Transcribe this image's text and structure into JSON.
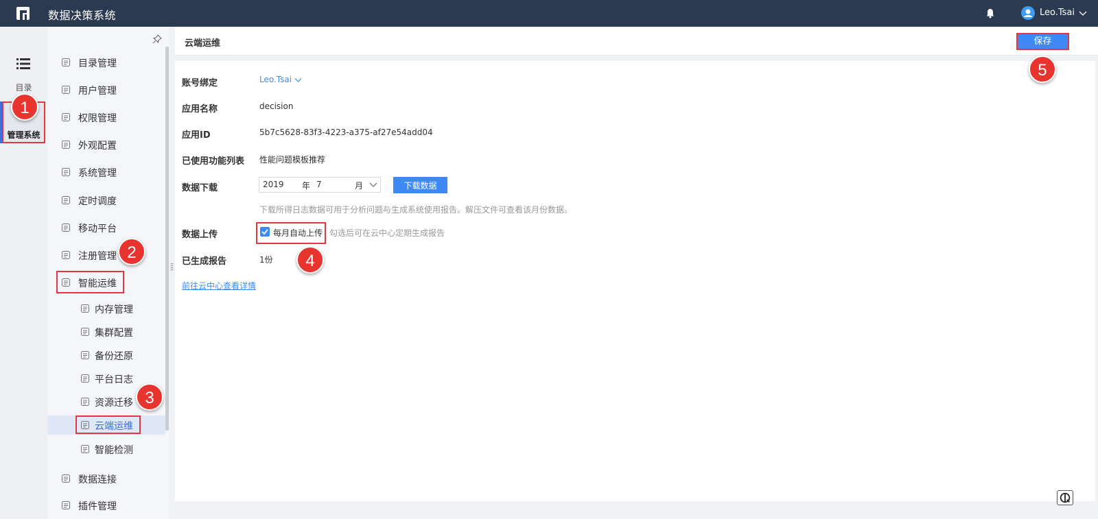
{
  "app": {
    "title": "数据决策系统"
  },
  "header": {
    "user_name": "Leo.Tsai"
  },
  "rail": {
    "catalog_label": "目录",
    "admin_label": "管理系统"
  },
  "nav": {
    "items": [
      {
        "label": "目录管理",
        "icon": "catalog-icon"
      },
      {
        "label": "用户管理",
        "icon": "user-icon"
      },
      {
        "label": "权限管理",
        "icon": "lock-icon"
      },
      {
        "label": "外观配置",
        "icon": "brush-icon"
      },
      {
        "label": "系统管理",
        "icon": "gear-icon"
      },
      {
        "label": "定时调度",
        "icon": "timer-icon"
      },
      {
        "label": "移动平台",
        "icon": "mobile-icon"
      },
      {
        "label": "注册管理",
        "icon": "register-icon"
      },
      {
        "label": "智能运维",
        "icon": "ops-icon"
      }
    ],
    "sub_items": [
      {
        "label": "内存管理",
        "icon": "memory-icon"
      },
      {
        "label": "集群配置",
        "icon": "cluster-icon"
      },
      {
        "label": "备份还原",
        "icon": "backup-icon"
      },
      {
        "label": "平台日志",
        "icon": "log-icon"
      },
      {
        "label": "资源迁移",
        "icon": "migrate-icon"
      },
      {
        "label": "云端运维",
        "icon": "cloud-ops-icon",
        "active": true
      },
      {
        "label": "智能检测",
        "icon": "monitor-icon"
      }
    ],
    "bottom_items": [
      {
        "label": "数据连接",
        "icon": "link-icon"
      },
      {
        "label": "插件管理",
        "icon": "plugin-icon"
      }
    ]
  },
  "main": {
    "title": "云端运维",
    "save_label": "保存",
    "fields": {
      "account_label": "账号绑定",
      "account_value": "Leo.Tsai",
      "app_name_label": "应用名称",
      "app_name_value": "decision",
      "app_id_label": "应用ID",
      "app_id_value": "5b7c5628-83f3-4223-a375-af27e54add04",
      "features_label": "已使用功能列表",
      "features_value": "性能问题模板推荐",
      "download_label": "数据下载",
      "year_value": "2019",
      "year_unit": "年",
      "month_value": "7",
      "month_unit": "月",
      "download_button": "下载数据",
      "download_hint": "下载所得日志数据可用于分析问题与生成系统使用报告。解压文件可查看该月份数据。",
      "upload_label": "数据上传",
      "upload_checkbox_label": "每月自动上传",
      "upload_checked": true,
      "upload_hint": "勾选后可在云中心定期生成报告",
      "reports_label": "已生成报告",
      "reports_value": "1份",
      "detail_link": "前往云中心查看详情"
    }
  },
  "badges": [
    "1",
    "2",
    "3",
    "4",
    "5"
  ],
  "colors": {
    "topbar": "#2b3a51",
    "accent": "#3d8af7",
    "highlight": "#e0383e",
    "badge": "#e8342f"
  }
}
